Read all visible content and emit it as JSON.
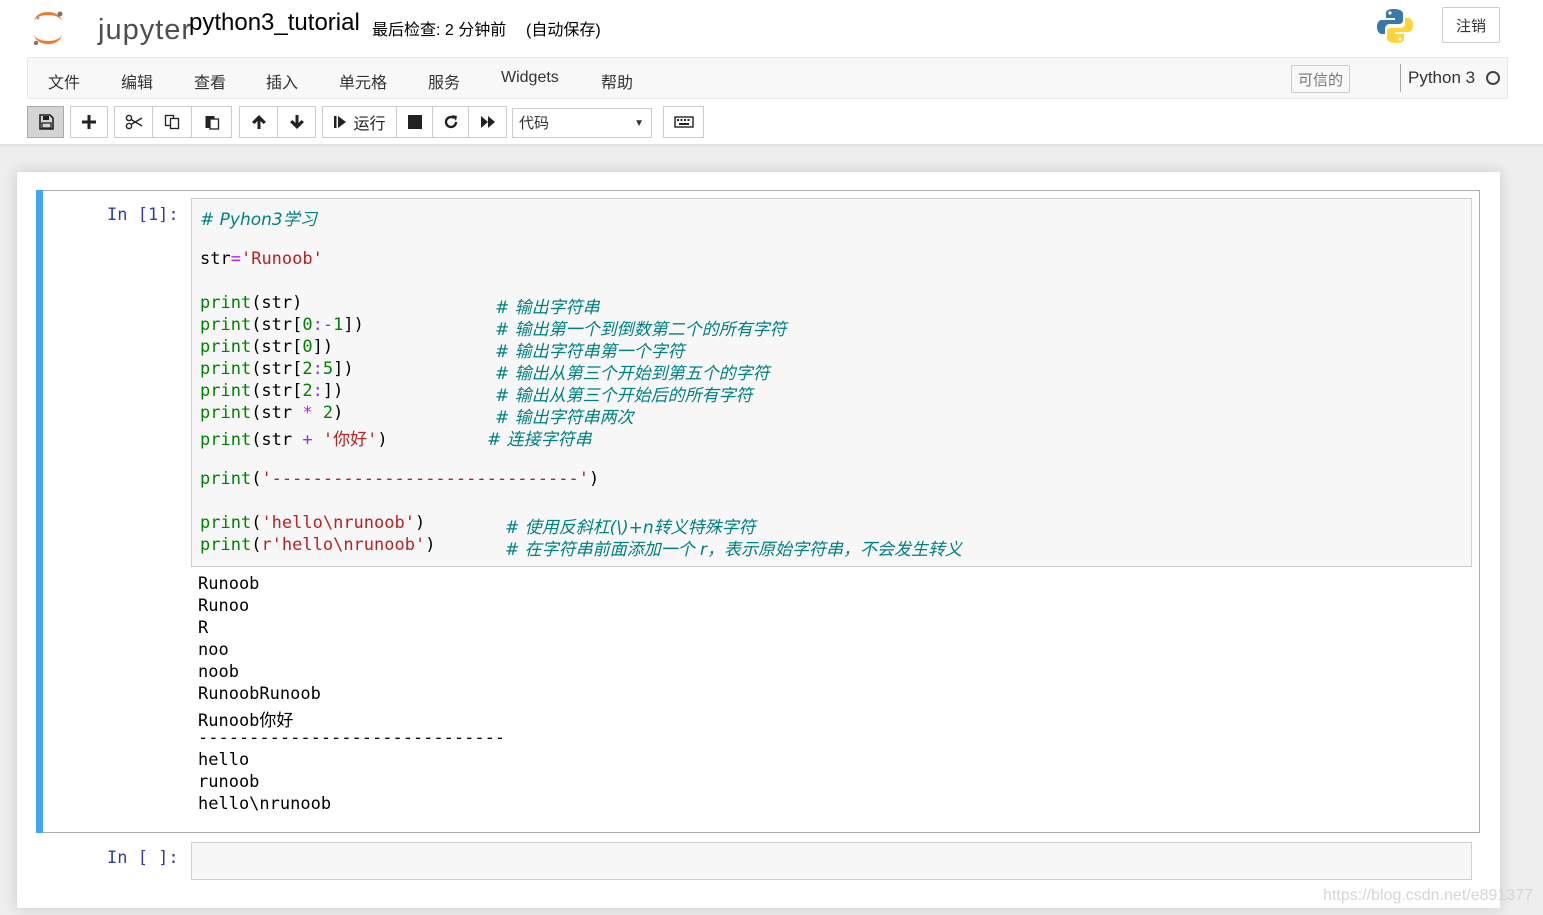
{
  "header": {
    "brand": "jupyter",
    "notebook_title": "python3_tutorial",
    "checkpoint": "最后检查: 2 分钟前",
    "autosave": "(自动保存)",
    "logout_label": "注销"
  },
  "menubar": {
    "items": [
      "文件",
      "编辑",
      "查看",
      "插入",
      "单元格",
      "服务",
      "Widgets",
      "帮助"
    ],
    "trusted_label": "可信的",
    "kernel_name": "Python 3"
  },
  "toolbar": {
    "run_label": "运行",
    "cell_type": "代码"
  },
  "cells": [
    {
      "prompt": "In [1]:",
      "code": {
        "line1_comment": "# Pyhon3学习",
        "line2": "str='Runoob'",
        "print_lines": [
          {
            "code": "print(str)",
            "comment": "# 输出字符串"
          },
          {
            "code": "print(str[0:-1])",
            "comment": "# 输出第一个到倒数第二个的所有字符"
          },
          {
            "code": "print(str[0])",
            "comment": "# 输出字符串第一个字符"
          },
          {
            "code": "print(str[2:5])",
            "comment": "# 输出从第三个开始到第五个的字符"
          },
          {
            "code": "print(str[2:])",
            "comment": "# 输出从第三个开始后的所有字符"
          },
          {
            "code": "print(str * 2)",
            "comment": "# 输出字符串两次"
          },
          {
            "code": "print(str + '你好')",
            "comment": "# 连接字符串"
          }
        ],
        "dash_line": "print('------------------------------')",
        "escape_lines": [
          {
            "code": "print('hello\\nrunoob')",
            "comment": "# 使用反斜杠(\\)+n转义特殊字符"
          },
          {
            "code": "print(r'hello\\nrunoob')",
            "comment": "# 在字符串前面添加一个 r，表示原始字符串，不会发生转义"
          }
        ]
      },
      "output": [
        "Runoob",
        "Runoo",
        "R",
        "noo",
        "noob",
        "RunoobRunoob",
        "Runoob你好",
        "------------------------------",
        "hello",
        "runoob",
        "hello\\nrunoob"
      ]
    },
    {
      "prompt": "In [ ]:"
    }
  ],
  "watermark": "https://blog.csdn.net/e891377"
}
